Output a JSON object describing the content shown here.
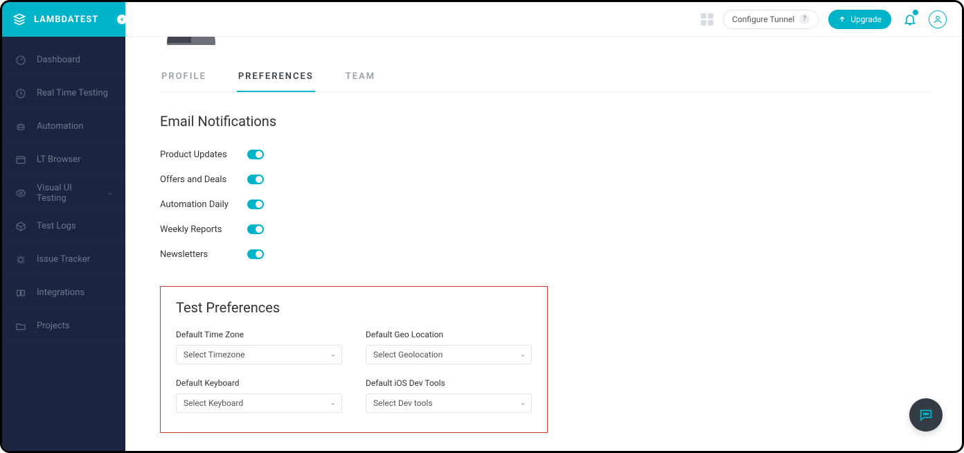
{
  "brand": "LAMBDATEST",
  "sidebar": {
    "items": [
      {
        "label": "Dashboard"
      },
      {
        "label": "Real Time Testing"
      },
      {
        "label": "Automation"
      },
      {
        "label": "LT Browser"
      },
      {
        "label": "Visual UI Testing",
        "hasSubmenu": true
      },
      {
        "label": "Test Logs"
      },
      {
        "label": "Issue Tracker"
      },
      {
        "label": "Integrations"
      },
      {
        "label": "Projects"
      }
    ]
  },
  "topbar": {
    "configure_tunnel": "Configure Tunnel",
    "upgrade": "Upgrade"
  },
  "tabs": {
    "profile": "PROFILE",
    "preferences": "PREFERENCES",
    "team": "TEAM"
  },
  "notifications": {
    "title": "Email Notifications",
    "items": [
      {
        "label": "Product Updates"
      },
      {
        "label": "Offers and Deals"
      },
      {
        "label": "Automation Daily"
      },
      {
        "label": "Weekly Reports"
      },
      {
        "label": "Newsletters"
      }
    ]
  },
  "test_prefs": {
    "title": "Test Preferences",
    "timezone_label": "Default Time Zone",
    "timezone_value": "Select Timezone",
    "geo_label": "Default Geo Location",
    "geo_value": "Select Geolocation",
    "keyboard_label": "Default Keyboard",
    "keyboard_value": "Select Keyboard",
    "ios_label": "Default iOS Dev Tools",
    "ios_value": "Select Dev tools"
  }
}
